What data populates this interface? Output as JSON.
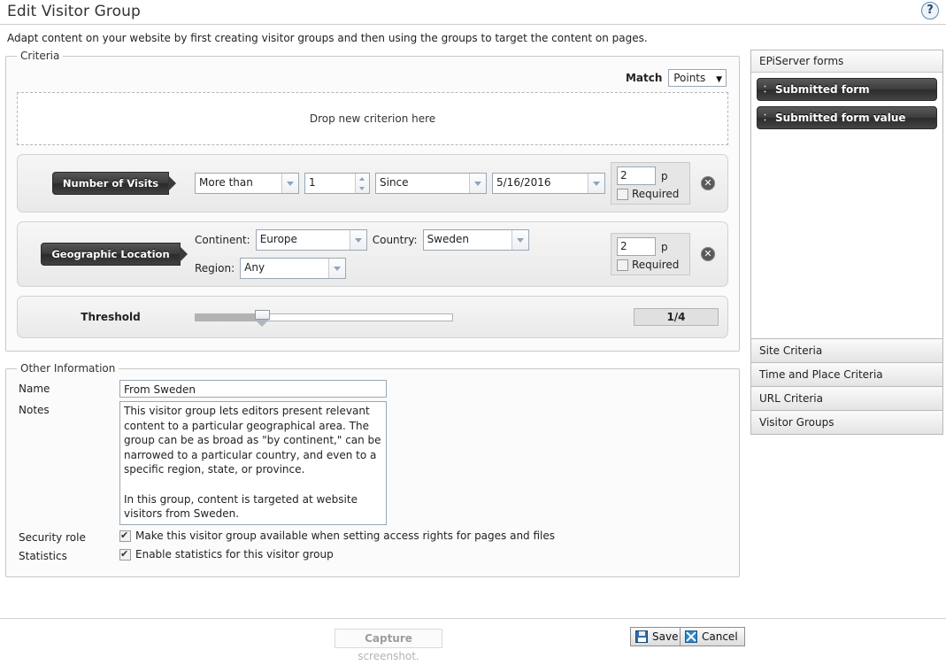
{
  "header": {
    "title": "Edit Visitor Group",
    "help_icon": "question-mark-icon",
    "help_label": "?"
  },
  "intro": "Adapt content on your website by first creating visitor groups and then using the groups to target the content on pages.",
  "criteria": {
    "legend": "Criteria",
    "match_label": "Match",
    "match_value": "Points",
    "match_caret": "▼",
    "drop_zone_text": "Drop new criterion here",
    "delete_icon_label": "✕",
    "rows": [
      {
        "tag": "Number of Visits",
        "operator": "More than",
        "count": "1",
        "timeframe": "Since",
        "date": "5/16/2016",
        "points": "2",
        "points_unit": "p",
        "required_label": "Required",
        "required_checked": false
      },
      {
        "tag": "Geographic Location",
        "continent_label": "Continent:",
        "continent_value": "Europe",
        "country_label": "Country:",
        "country_value": "Sweden",
        "region_label": "Region:",
        "region_value": "Any",
        "points": "2",
        "points_unit": "p",
        "required_label": "Required",
        "required_checked": false
      }
    ],
    "threshold": {
      "label": "Threshold",
      "value": "1/4",
      "slider_percent": 26
    }
  },
  "other_information": {
    "legend": "Other Information",
    "name_label": "Name",
    "name_value": "From Sweden",
    "notes_label": "Notes",
    "notes_value": "This visitor group lets editors present relevant content to a particular geographical area. The group can be as broad as \"by continent,\" can be narrowed to a particular country, and even to a specific region, state, or province.\n\nIn this group, content is targeted at website visitors from Sweden.",
    "security_role_label": "Security role",
    "security_role_text": "Make this visitor group available when setting access rights for pages and files",
    "security_role_checked": true,
    "statistics_label": "Statistics",
    "statistics_text": "Enable statistics for this visitor group",
    "statistics_checked": true
  },
  "sidebar": {
    "panel_title": "EPiServer forms",
    "drag_items": [
      {
        "label": "Submitted form",
        "icon": "drag-handle-icon"
      },
      {
        "label": "Submitted form value",
        "icon": "drag-handle-icon"
      }
    ],
    "accordion_items": [
      "Site Criteria",
      "Time and Place Criteria",
      "URL Criteria",
      "Visitor Groups"
    ]
  },
  "footer": {
    "capture_bold": "Capture",
    "capture_rest": " screenshot.",
    "save_label": "Save",
    "save_icon": "floppy-disk-icon",
    "cancel_label": "Cancel",
    "cancel_icon": "cancel-x-icon"
  }
}
